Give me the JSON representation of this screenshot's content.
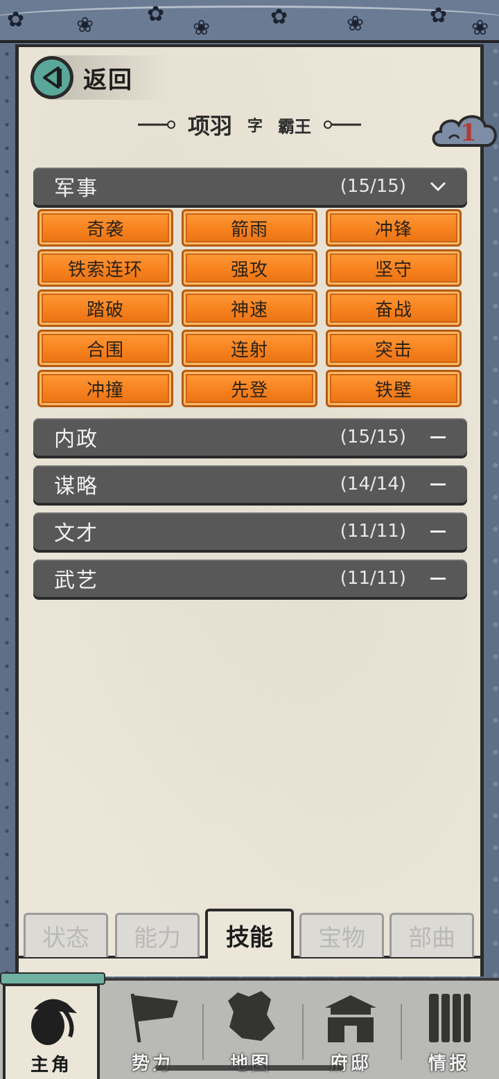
{
  "header": {
    "back_label": "返回",
    "name": "项羽",
    "zi_label": "字",
    "title_name": "霸王",
    "badge_count": "1"
  },
  "sections": [
    {
      "title": "军事",
      "count": "(15/15)",
      "expanded": true,
      "skills": [
        "奇袭",
        "箭雨",
        "冲锋",
        "铁索连环",
        "强攻",
        "坚守",
        "踏破",
        "神速",
        "奋战",
        "合围",
        "连射",
        "突击",
        "冲撞",
        "先登",
        "铁壁"
      ]
    },
    {
      "title": "内政",
      "count": "(15/15)",
      "expanded": false
    },
    {
      "title": "谋略",
      "count": "(14/14)",
      "expanded": false
    },
    {
      "title": "文才",
      "count": "(11/11)",
      "expanded": false
    },
    {
      "title": "武艺",
      "count": "(11/11)",
      "expanded": false
    }
  ],
  "sub_tabs": [
    {
      "label": "状态",
      "active": false
    },
    {
      "label": "能力",
      "active": false
    },
    {
      "label": "技能",
      "active": true
    },
    {
      "label": "宝物",
      "active": false
    },
    {
      "label": "部曲",
      "active": false
    }
  ],
  "bottom_nav": [
    {
      "label": "主角",
      "icon": "hero-icon",
      "active": true
    },
    {
      "label": "势力",
      "icon": "flag-icon",
      "active": false
    },
    {
      "label": "地图",
      "icon": "map-icon",
      "active": false
    },
    {
      "label": "府邸",
      "icon": "mansion-icon",
      "active": false
    },
    {
      "label": "情报",
      "icon": "scroll-icon",
      "active": false
    }
  ],
  "colors": {
    "skill_orange": "#f7821e",
    "section_gray": "#585858",
    "parchment": "#ebe6d8",
    "frame_blue": "#5e6f86",
    "accent_teal": "#5aa89a",
    "badge_red": "#b23b33"
  }
}
